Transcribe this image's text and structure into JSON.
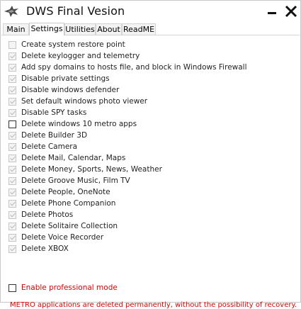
{
  "window": {
    "title": "DWS Final Vesion"
  },
  "tabs": [
    {
      "label": "Main",
      "active": false
    },
    {
      "label": "Settings",
      "active": true
    },
    {
      "label": "Utilities",
      "active": false
    },
    {
      "label": "About",
      "active": false
    },
    {
      "label": "ReadME",
      "active": false
    }
  ],
  "options": [
    {
      "label": "Create system restore point",
      "checked": false,
      "enabled": false
    },
    {
      "label": "Delete keylogger and telemetry",
      "checked": true,
      "enabled": false
    },
    {
      "label": "Add spy domains to hosts file, and block in Windows Firewall",
      "checked": true,
      "enabled": false
    },
    {
      "label": "Disable private settings",
      "checked": true,
      "enabled": false
    },
    {
      "label": "Disable windows defender",
      "checked": true,
      "enabled": false
    },
    {
      "label": "Set default windows photo viewer",
      "checked": true,
      "enabled": false
    },
    {
      "label": "Disable SPY tasks",
      "checked": true,
      "enabled": false
    },
    {
      "label": "Delete windows 10 metro apps",
      "checked": false,
      "enabled": true
    },
    {
      "label": "Delete Builder 3D",
      "checked": true,
      "enabled": false
    },
    {
      "label": "Delete Camera",
      "checked": true,
      "enabled": false
    },
    {
      "label": "Delete Mail, Calendar, Maps",
      "checked": true,
      "enabled": false
    },
    {
      "label": "Delete Money, Sports, News, Weather",
      "checked": true,
      "enabled": false
    },
    {
      "label": "Delete Groove Music, Film TV",
      "checked": true,
      "enabled": false
    },
    {
      "label": "Delete People, OneNote",
      "checked": true,
      "enabled": false
    },
    {
      "label": "Delete Phone Companion",
      "checked": true,
      "enabled": false
    },
    {
      "label": "Delete Photos",
      "checked": true,
      "enabled": false
    },
    {
      "label": "Delete Solitaire Collection",
      "checked": true,
      "enabled": false
    },
    {
      "label": "Delete Voice Recorder",
      "checked": true,
      "enabled": false
    },
    {
      "label": "Delete XBOX",
      "checked": true,
      "enabled": false
    }
  ],
  "warning": "METRO applications are deleted permanently, without the possibility of recovery.",
  "professional_mode": {
    "label": "Enable professional mode",
    "checked": false
  },
  "colors": {
    "warning_text": "#e00000",
    "disabled_text": "#222222"
  }
}
